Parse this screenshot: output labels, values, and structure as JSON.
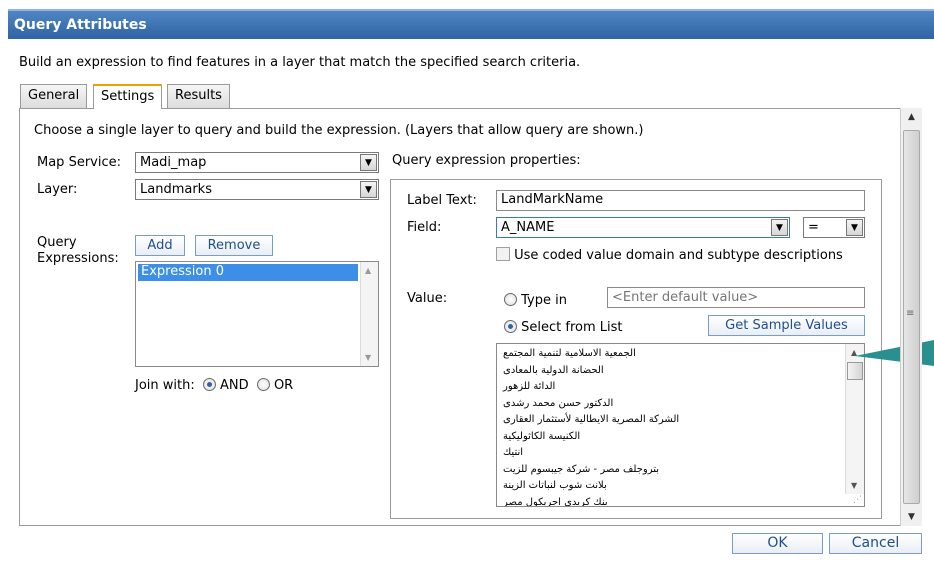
{
  "dialog": {
    "title": "Query Attributes",
    "description": "Build an expression to find features in a layer that match the specified search criteria."
  },
  "tabs": [
    {
      "label": "General"
    },
    {
      "label": "Settings"
    },
    {
      "label": "Results"
    }
  ],
  "settings": {
    "instruction": "Choose a single layer to query and build the expression. (Layers that allow query are shown.)",
    "map_service_label": "Map Service:",
    "map_service_value": "Madi_map",
    "layer_label": "Layer:",
    "layer_value": "Landmarks",
    "query_expressions_label_1": "Query",
    "query_expressions_label_2": "Expressions:",
    "add_label": "Add",
    "remove_label": "Remove",
    "expressions": [
      "Expression 0"
    ],
    "join_with_label": "Join with:",
    "join_and": "AND",
    "join_or": "OR",
    "join_selected": "AND"
  },
  "properties": {
    "heading": "Query expression properties:",
    "label_text_label": "Label Text:",
    "label_text_value": "LandMarkName",
    "field_label": "Field:",
    "field_value": "A_NAME",
    "operator_value": "=",
    "coded_value_label": "Use coded value domain and subtype descriptions",
    "value_label": "Value:",
    "type_in_label": "Type in",
    "default_value_placeholder": "<Enter default value>",
    "select_from_list_label": "Select from List",
    "value_mode": "Select from List",
    "get_sample_values_label": "Get Sample Values",
    "sample_values": [
      "الجمعية الاسلامية لتنمية المجتمع",
      "الحضانة الدولية بالمعادى",
      "الدائة للزهور",
      "الدكتور حسن محمد رشدى",
      "الشركة المصرية الايطالية لأستثمار العقارى",
      "الكنيسة الكاثوليكية",
      "انتيك",
      "بتروجلف مصر - شركة جيبسوم للزيت",
      "بلانت شوب لنباتات الزينة",
      "بنك كريدى اجريكول مصر"
    ]
  },
  "footer": {
    "ok_label": "OK",
    "cancel_label": "Cancel"
  },
  "colors": {
    "title_bar": "#3a72b4",
    "link_blue": "#1e4f8c",
    "selection": "#3d8ee6",
    "callout": "#2a8f8f"
  }
}
